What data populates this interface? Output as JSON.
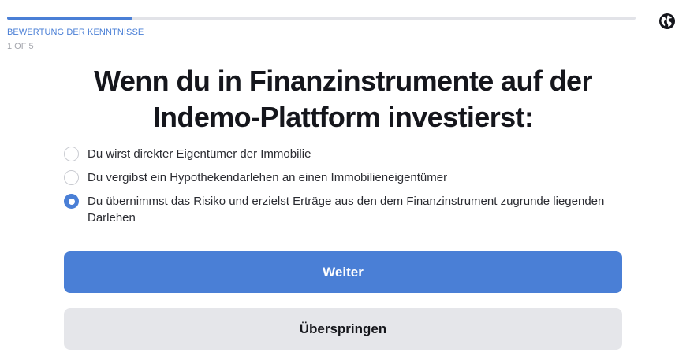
{
  "progress": {
    "section_title": "BEWERTUNG DER KENNTNISSE",
    "step_text": "1 OF 5",
    "fraction": 0.2
  },
  "header": {
    "language_icon": "globe-icon"
  },
  "question": {
    "text": "Wenn du in Finanzinstrumente auf der Indemo-Plattform investierst:"
  },
  "options": [
    {
      "label": "Du wirst direkter Eigentümer der Immobilie",
      "selected": false
    },
    {
      "label": "Du vergibst ein Hypothekendarlehen an einen Immobilieneigentümer",
      "selected": false
    },
    {
      "label": "Du übernimmst das Risiko und erzielst Erträge aus den dem Finanzinstrument zugrunde liegenden Darlehen",
      "selected": true
    }
  ],
  "buttons": {
    "next_label": "Weiter",
    "skip_label": "Überspringen"
  },
  "colors": {
    "accent": "#4a7fd6",
    "secondary_button": "#e5e6ea"
  }
}
